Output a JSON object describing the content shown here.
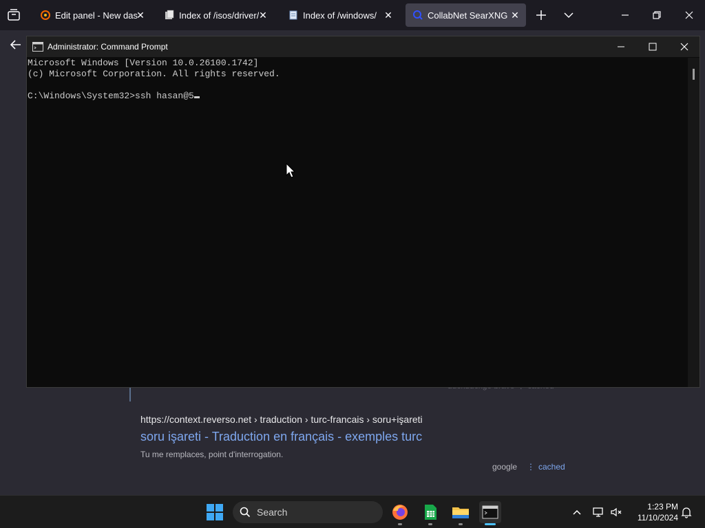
{
  "browser": {
    "tabs": [
      {
        "label": "Edit panel - New dashb",
        "icon": "grafana-icon",
        "active": false
      },
      {
        "label": "Index of /isos/driver/",
        "icon": "folder-index-icon",
        "active": false
      },
      {
        "label": "Index of /windows/",
        "icon": "page-index-icon",
        "active": false
      },
      {
        "label": "CollabNet SearXNG",
        "icon": "searxng-icon",
        "active": true
      }
    ],
    "close_glyph": "✕"
  },
  "page": {
    "faded_meta": "duckduckgo  brave   ⋮  cached",
    "result": {
      "url": "https://context.reverso.net  › traduction › turc-francais › soru+işareti",
      "title": "soru işareti - Traduction en français - exemples turc",
      "snippet": "Tu me remplaces, point d'interrogation.",
      "engine": "google",
      "separator": "⋮",
      "cached": "cached"
    }
  },
  "cmd": {
    "title": "Administrator: Command Prompt",
    "lines": [
      "Microsoft Windows [Version 10.0.26100.1742]",
      "(c) Microsoft Corporation. All rights reserved.",
      "",
      "C:\\Windows\\System32>ssh hasan@5"
    ]
  },
  "taskbar": {
    "search_label": "Search",
    "time": "1:23 PM",
    "date": "11/10/2024",
    "apps": [
      "firefox-icon",
      "spreadsheet-icon",
      "file-explorer-icon",
      "terminal-icon"
    ]
  },
  "colors": {
    "accent": "#4cc2ff",
    "link": "#7ea7ee",
    "console_bg": "#0c0c0c"
  }
}
